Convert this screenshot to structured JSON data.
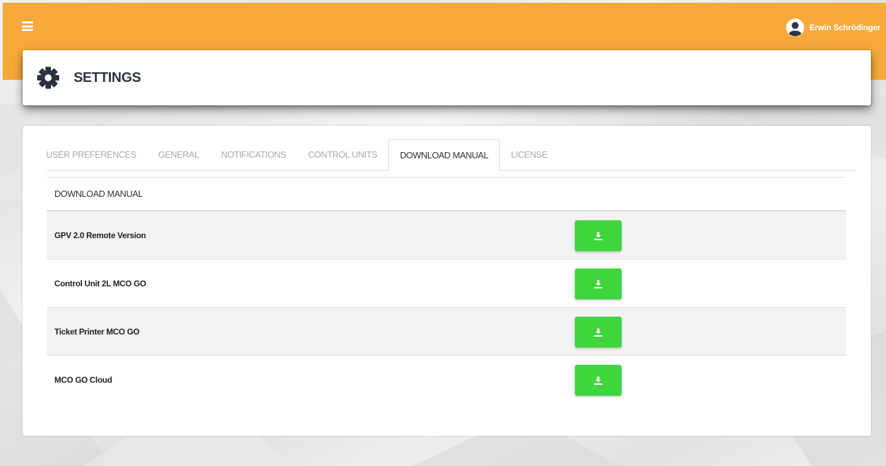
{
  "header": {
    "menu_icon": "hamburger-icon",
    "user": {
      "name": "Erwin Schrödinger",
      "icon": "user-avatar-icon"
    },
    "color": "#f5a93a"
  },
  "page": {
    "title": "SETTINGS",
    "icon": "gear-icon"
  },
  "tabs": [
    {
      "label": "USER PREFERENCES",
      "active": false
    },
    {
      "label": "GENERAL",
      "active": false
    },
    {
      "label": "NOTIFICATIONS",
      "active": false
    },
    {
      "label": "CONTROL UNITS",
      "active": false
    },
    {
      "label": "DOWNLOAD MANUAL",
      "active": true
    },
    {
      "label": "LICENSE",
      "active": false
    }
  ],
  "section": {
    "title": "DOWNLOAD MANUAL",
    "rows": [
      {
        "label": "GPV 2.0 Remote Version",
        "button_icon": "download-icon"
      },
      {
        "label": "Control Unit 2L MCO GO",
        "button_icon": "download-icon"
      },
      {
        "label": "Ticket Printer MCO GO",
        "button_icon": "download-icon"
      },
      {
        "label": "MCO GO Cloud",
        "button_icon": "download-icon"
      }
    ]
  },
  "colors": {
    "download_button": "#3fd63b",
    "title_text": "#2d3340"
  }
}
